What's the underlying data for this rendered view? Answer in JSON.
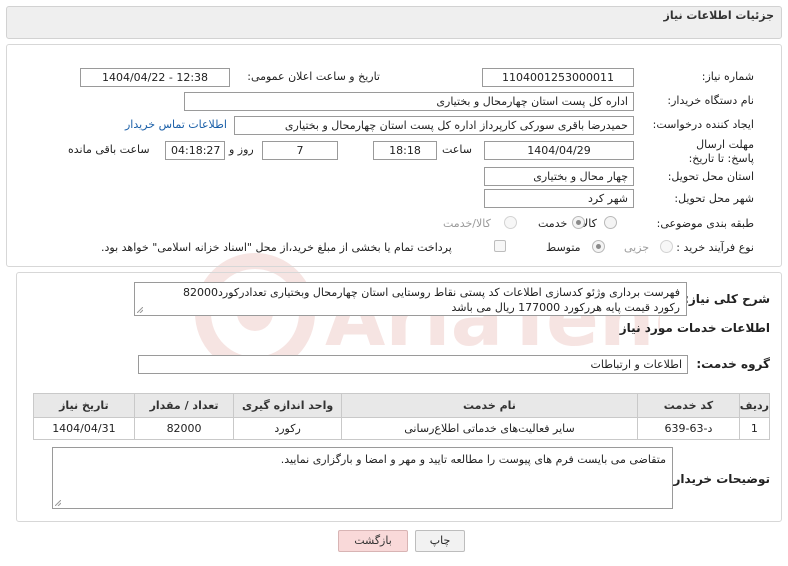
{
  "header": {
    "title": "جزئیات اطلاعات نیاز"
  },
  "need_number": {
    "label": "شماره نیاز:",
    "value": "1104001253000011"
  },
  "announce_date": {
    "label": "تاریخ و ساعت اعلان عمومی:",
    "value": "1404/04/22 - 12:38"
  },
  "buyer_org": {
    "label": "نام دستگاه خریدار:",
    "value": "اداره کل پست استان چهارمحال و بختیاری"
  },
  "requester": {
    "label": "ایجاد کننده درخواست:",
    "value": "حمیدرضا باقری سورکی کارپرداز اداره کل پست استان چهارمحال و بختیاری",
    "contact_link": "اطلاعات تماس خریدار"
  },
  "deadline": {
    "label": "مهلت ارسال پاسخ: تا تاریخ:",
    "date": "1404/04/29",
    "time_label": "ساعت",
    "time": "18:18",
    "days": "7",
    "days_label": "روز و",
    "remaining": "04:18:27",
    "remaining_label": "ساعت باقی مانده"
  },
  "delivery_province": {
    "label": "استان محل تحویل:",
    "value": "چهار محال و بختیاری"
  },
  "delivery_city": {
    "label": "شهر محل تحویل:",
    "value": "شهر کرد"
  },
  "category": {
    "label": "طبقه بندی موضوعی:",
    "options": [
      "کالا",
      "خدمت",
      "کالا/خدمت"
    ],
    "selected": "خدمت"
  },
  "process": {
    "label": "نوع فرآیند خرید :",
    "options": [
      "جزیی",
      "متوسط"
    ],
    "selected": "متوسط",
    "payment_note": "پرداخت تمام یا بخشی از مبلغ خرید،از محل \"اسناد خزانه اسلامی\" خواهد بود."
  },
  "summary": {
    "label": "شرح کلی نیاز:",
    "line1": "فهرست برداری وژئو کدسازی اطلاعات کد پستی نقاط روستایی استان چهارمحال وبختیاری تعدادرکورد82000",
    "line2": "رکورد قیمت پایه هررکورد 177000 ریال می باشد"
  },
  "services_heading": "اطلاعات خدمات مورد نیاز",
  "service_group": {
    "label": "گروه خدمت:",
    "value": "اطلاعات و ارتباطات"
  },
  "table": {
    "headers": [
      "ردیف",
      "کد خدمت",
      "نام خدمت",
      "واحد اندازه گیری",
      "تعداد / مقدار",
      "تاریخ نیاز"
    ],
    "rows": [
      {
        "row": "1",
        "code": "د-63-639",
        "name": "سایر فعالیت‌های خدماتی اطلاع‌رسانی",
        "unit": "رکورد",
        "qty": "82000",
        "date": "1404/04/31"
      }
    ]
  },
  "buyer_notes": {
    "label": "توضیحات خریدار:",
    "value": "متقاضی می بایست فرم های پیوست را مطالعه تایید و مهر و امضا و بارگزاری نمایید."
  },
  "buttons": {
    "print": "چاپ",
    "back": "بازگشت"
  },
  "watermark": "AriaTender.neT",
  "colors": {
    "link": "#1a5fa8",
    "back_button": "#f9d9d9",
    "header_bg": "#efefef"
  }
}
